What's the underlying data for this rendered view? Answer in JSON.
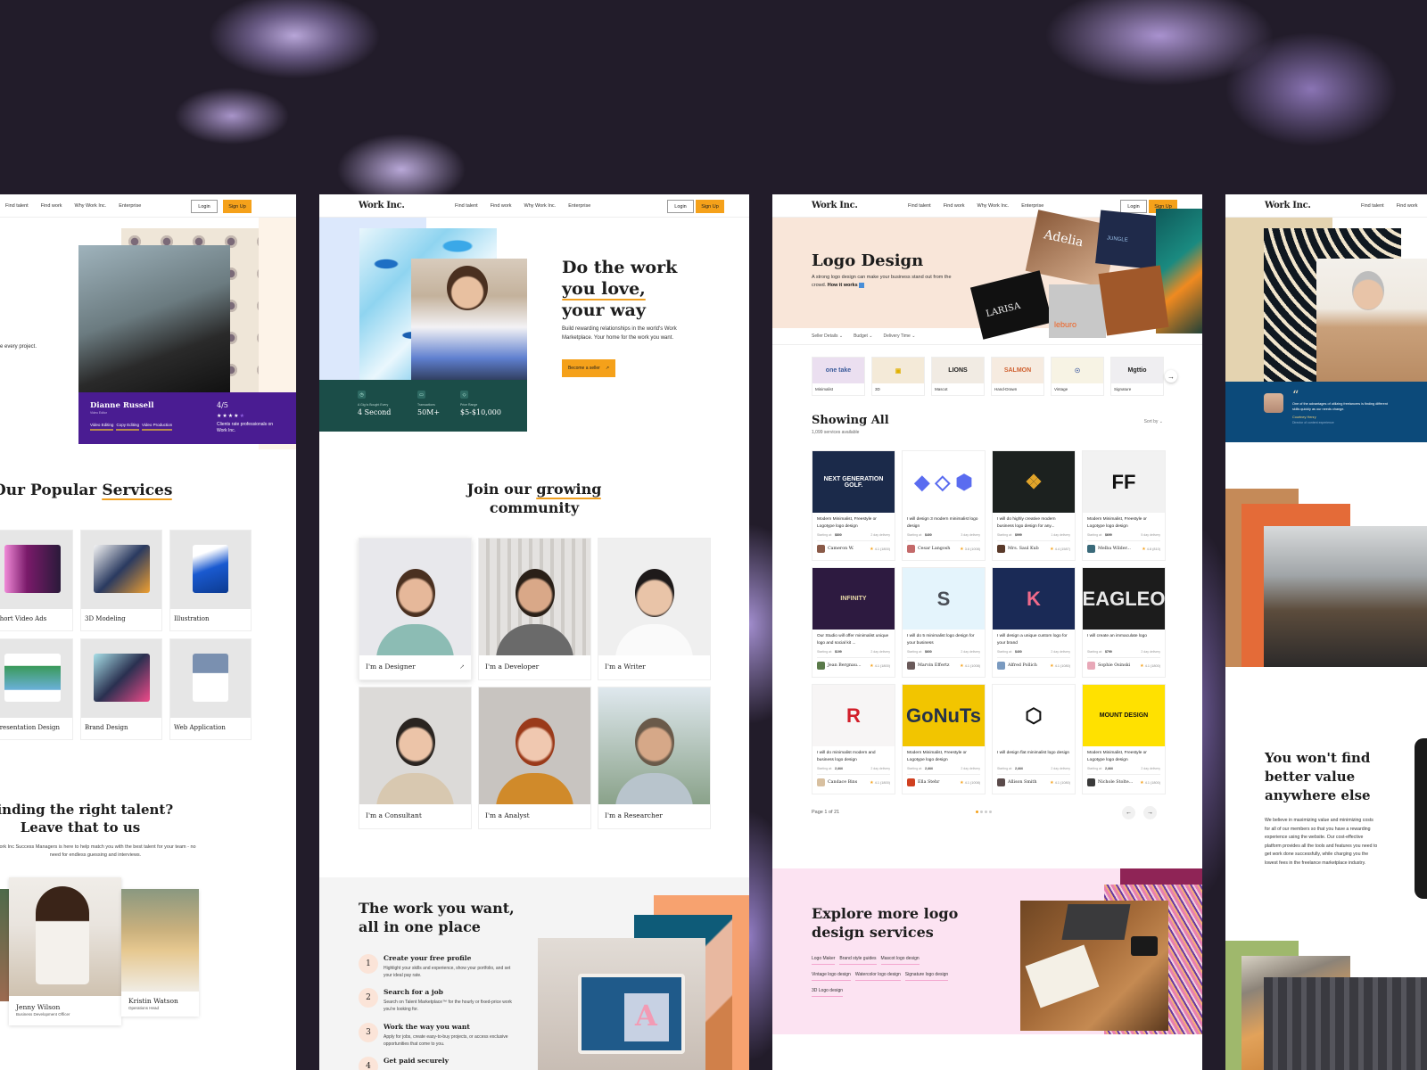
{
  "nav": {
    "brand": "Work Inc.",
    "links": [
      "Find talent",
      "Find work",
      "Why Work Inc.",
      "Enterprise"
    ],
    "login": "Login",
    "signup": "Sign Up"
  },
  "page1": {
    "hero_text_fragment": "e every project.",
    "featured": {
      "name": "Dianne Russell",
      "role": "Video Editor",
      "tags": [
        "Video Editing",
        "Copy Editing",
        "Video Production"
      ],
      "rating": "4/5",
      "stars_filled": 4,
      "stars_total": 5,
      "rating_text": "Clients rate professionals on Work Inc."
    },
    "popular_title_pre": "Our Popular ",
    "popular_title_hl": "Services",
    "services": [
      "Short Video Ads",
      "3D Modeling",
      "Illustration",
      "Presentation Design",
      "Brand Design",
      "Web Application"
    ],
    "talent_title_l1": "Finding the right talent?",
    "talent_title_l2": "Leave that to us",
    "talent_desc": "Work Inc Success Managers is here to help match you with the best talent for your team - no need for endless guessing and interviews.",
    "managers": [
      {
        "name": "Jenny Wilson",
        "role": "Business Development Officer"
      },
      {
        "name": "Kristin Watson",
        "role": "Operations Head"
      }
    ]
  },
  "page2": {
    "headline_l1": "Do the work",
    "headline_l2": "you love,",
    "headline_l3": "your way",
    "subtitle": "Build rewarding relationships in the world's Work Marketplace. Your home for the work you want.",
    "cta": "Become a seller",
    "stats": [
      {
        "icon": "clock-icon",
        "label": "A Gig Is Bought Every",
        "value": "4 Second"
      },
      {
        "icon": "transactions-icon",
        "label": "Transactions",
        "value": "50M+"
      },
      {
        "icon": "tag-icon",
        "label": "Price Range",
        "value": "$5-$10,000"
      }
    ],
    "join_pre": "Join our ",
    "join_hl": "growing",
    "join_post": "community",
    "roles": [
      "I'm a Designer",
      "I'm a Developer",
      "I'm a Writer",
      "I'm a Consultant",
      "I'm a Analyst",
      "I'm a Researcher"
    ],
    "section2_title_l1": "The work you want,",
    "section2_title_l2": "all in one place",
    "steps": [
      {
        "num": "1",
        "title": "Create your free profile",
        "desc": "Highlight your skills and experience, show your portfolio, and set your ideal pay rate."
      },
      {
        "num": "2",
        "title": "Search for a job",
        "desc": "Search on Talent Marketplace™ for the hourly or fixed-price work you're looking for."
      },
      {
        "num": "3",
        "title": "Work the way you want",
        "desc": "Apply for jobs, create easy-to-buy projects, or access exclusive opportunities that come to you."
      },
      {
        "num": "4",
        "title": "Get paid securely",
        "desc": ""
      }
    ]
  },
  "page3": {
    "title": "Logo Design",
    "subtitle": "A strong logo design can make your business stand out from the crowd.",
    "how_it_works": "How it works",
    "collage_words": [
      "Adelia",
      "JUNGLE",
      "LARISA",
      "leburo"
    ],
    "filters": [
      "Seller Details",
      "Budget",
      "Delivery Time"
    ],
    "categories": [
      {
        "label": "Minimalist",
        "art": "one take",
        "bg": "#ebdff0",
        "fg": "#3a5a9a"
      },
      {
        "label": "3D",
        "art": "▣",
        "bg": "#f4ead8",
        "fg": "#e0b000"
      },
      {
        "label": "Mascot",
        "art": "LIONS",
        "bg": "#f1ebe3",
        "fg": "#1a1a1a"
      },
      {
        "label": "Hand-Drawn",
        "art": "SALMON",
        "bg": "#f6ebe0",
        "fg": "#d06030"
      },
      {
        "label": "Vintage",
        "art": "☉",
        "bg": "#f7f3e4",
        "fg": "#2a4a9a"
      },
      {
        "label": "Signature",
        "art": "Mgttio",
        "bg": "#efeef1",
        "fg": "#222"
      }
    ],
    "showing_title": "Showing All",
    "count": "1,099 services available",
    "sort": "Sort by",
    "gigs": [
      {
        "title": "Modern Minimalist, Freestyle or Logotype logo design",
        "price": "$800",
        "delivery": "2 day delivery",
        "seller": "Cameron W.",
        "rating": "4.1 (1800)",
        "bg": "#1b2a4a",
        "art": "NEXT GENERATION GOLF.",
        "fg": "#ffffff"
      },
      {
        "title": "I will design 3 modern minimalist logo design",
        "price": "$400",
        "delivery": "3 day delivery",
        "seller": "Cesar Langosh",
        "rating": "3.6 (1008)",
        "bg": "#ffffff",
        "art": "◆ ◇ ⬢",
        "fg": "#5a6cf0"
      },
      {
        "title": "I will do highly creative modern business logo design for any...",
        "price": "$999",
        "delivery": "1 day delivery",
        "seller": "Mrs. Saul Kub",
        "rating": "4.4 (1587)",
        "bg": "#1c211f",
        "art": "❖",
        "fg": "#e2a52a"
      },
      {
        "title": "Modern Minimalist, Freestyle or Logotype logo design",
        "price": "$699",
        "delivery": "5 day delivery",
        "seller": "Melba Wilder...",
        "rating": "4.8 (810)",
        "bg": "#f2f2f2",
        "art": "FF",
        "fg": "#111111"
      },
      {
        "title": "Our Studio will offer minimalist unique logo and social kit ...",
        "price": "$199",
        "delivery": "2 day delivery",
        "seller": "Jean Bergnau...",
        "rating": "4.1 (1800)",
        "bg": "#2d1a40",
        "art": "INFINITY",
        "fg": "#e8d9a8"
      },
      {
        "title": "I will do 5 minimalist logo design for your business",
        "price": "$600",
        "delivery": "2 day delivery",
        "seller": "Marvin Effertz",
        "rating": "4.1 (1008)",
        "bg": "#e4f4fc",
        "art": "S",
        "fg": "#4a4e56"
      },
      {
        "title": "I will design a unique custom logo for your brand",
        "price": "$400",
        "delivery": "2 day delivery",
        "seller": "Alfred Pollich",
        "rating": "4.1 (1080)",
        "bg": "#1a2a56",
        "art": "K",
        "fg": "#f06a8a"
      },
      {
        "title": "I will create an immaculate logo",
        "price": "$799",
        "delivery": "2 day delivery",
        "seller": "Sophie Osinski",
        "rating": "4.1 (1800)",
        "bg": "#1c1c1c",
        "art": "EAGLEO",
        "fg": "#e8e8e8"
      },
      {
        "title": "I will do minimalist modern and business logo design",
        "price": "2,444",
        "delivery": "2 day delivery",
        "seller": "Candace Bins",
        "rating": "4.1 (1800)",
        "bg": "#f7f5f5",
        "art": "R",
        "fg": "#d21f2a"
      },
      {
        "title": "Modern Minimalist, Freestyle or Logotype logo design",
        "price": "2,444",
        "delivery": "2 day delivery",
        "seller": "Ella Stehr",
        "rating": "4.1 (1008)",
        "bg": "#f2c500",
        "art": "GoNuTs",
        "fg": "#25324a"
      },
      {
        "title": "I will design flat minimalist logo design",
        "price": "2,444",
        "delivery": "2 day delivery",
        "seller": "Allison Smith",
        "rating": "4.1 (1080)",
        "bg": "#ffffff",
        "art": "⬡",
        "fg": "#111111"
      },
      {
        "title": "Modern Minimalist, Freestyle or Logotype logo design",
        "price": "2,444",
        "delivery": "2 day delivery",
        "seller": "Nichole Stoltе...",
        "rating": "4.1 (1800)",
        "bg": "#ffe100",
        "art": "MOUNT DESIGN",
        "fg": "#111111"
      }
    ],
    "starting_at": "Starting at:",
    "page_label": "Page 1 of 21",
    "page_dots": 4,
    "page_dot_active": 1,
    "explore_title_l1": "Explore more logo",
    "explore_title_l2": "design services",
    "explore_links": [
      "Logo Maker",
      "Brand style guides",
      "Mascot logo design",
      "Vintage logo design",
      "Watercolor logo design",
      "Signature logo design",
      "3D Logo design"
    ]
  },
  "page4": {
    "quote": "One of the advantages of utilizing freelancers is finding different skills quickly as our needs change.",
    "quote_author": "Courtney Henry",
    "quote_role": "Director of content experience",
    "value_title_l1": "You won't find",
    "value_title_l2": "better value",
    "value_title_l3": "anywhere else",
    "value_desc": "We believe in maximizing value and minimizing costs for all of our members so that you have a rewarding experience using the website. Our cost-effective platform provides all the tools and features you need to get work done successfully, while charging you the lowest fees in the freelance marketplace industry."
  },
  "colors": {
    "accent": "#f5a11a",
    "purple_card": "#4a1c92",
    "stats_green": "#1b4d48",
    "quote_blue": "#0c4a7a",
    "explore_pink": "#fce3f2"
  }
}
